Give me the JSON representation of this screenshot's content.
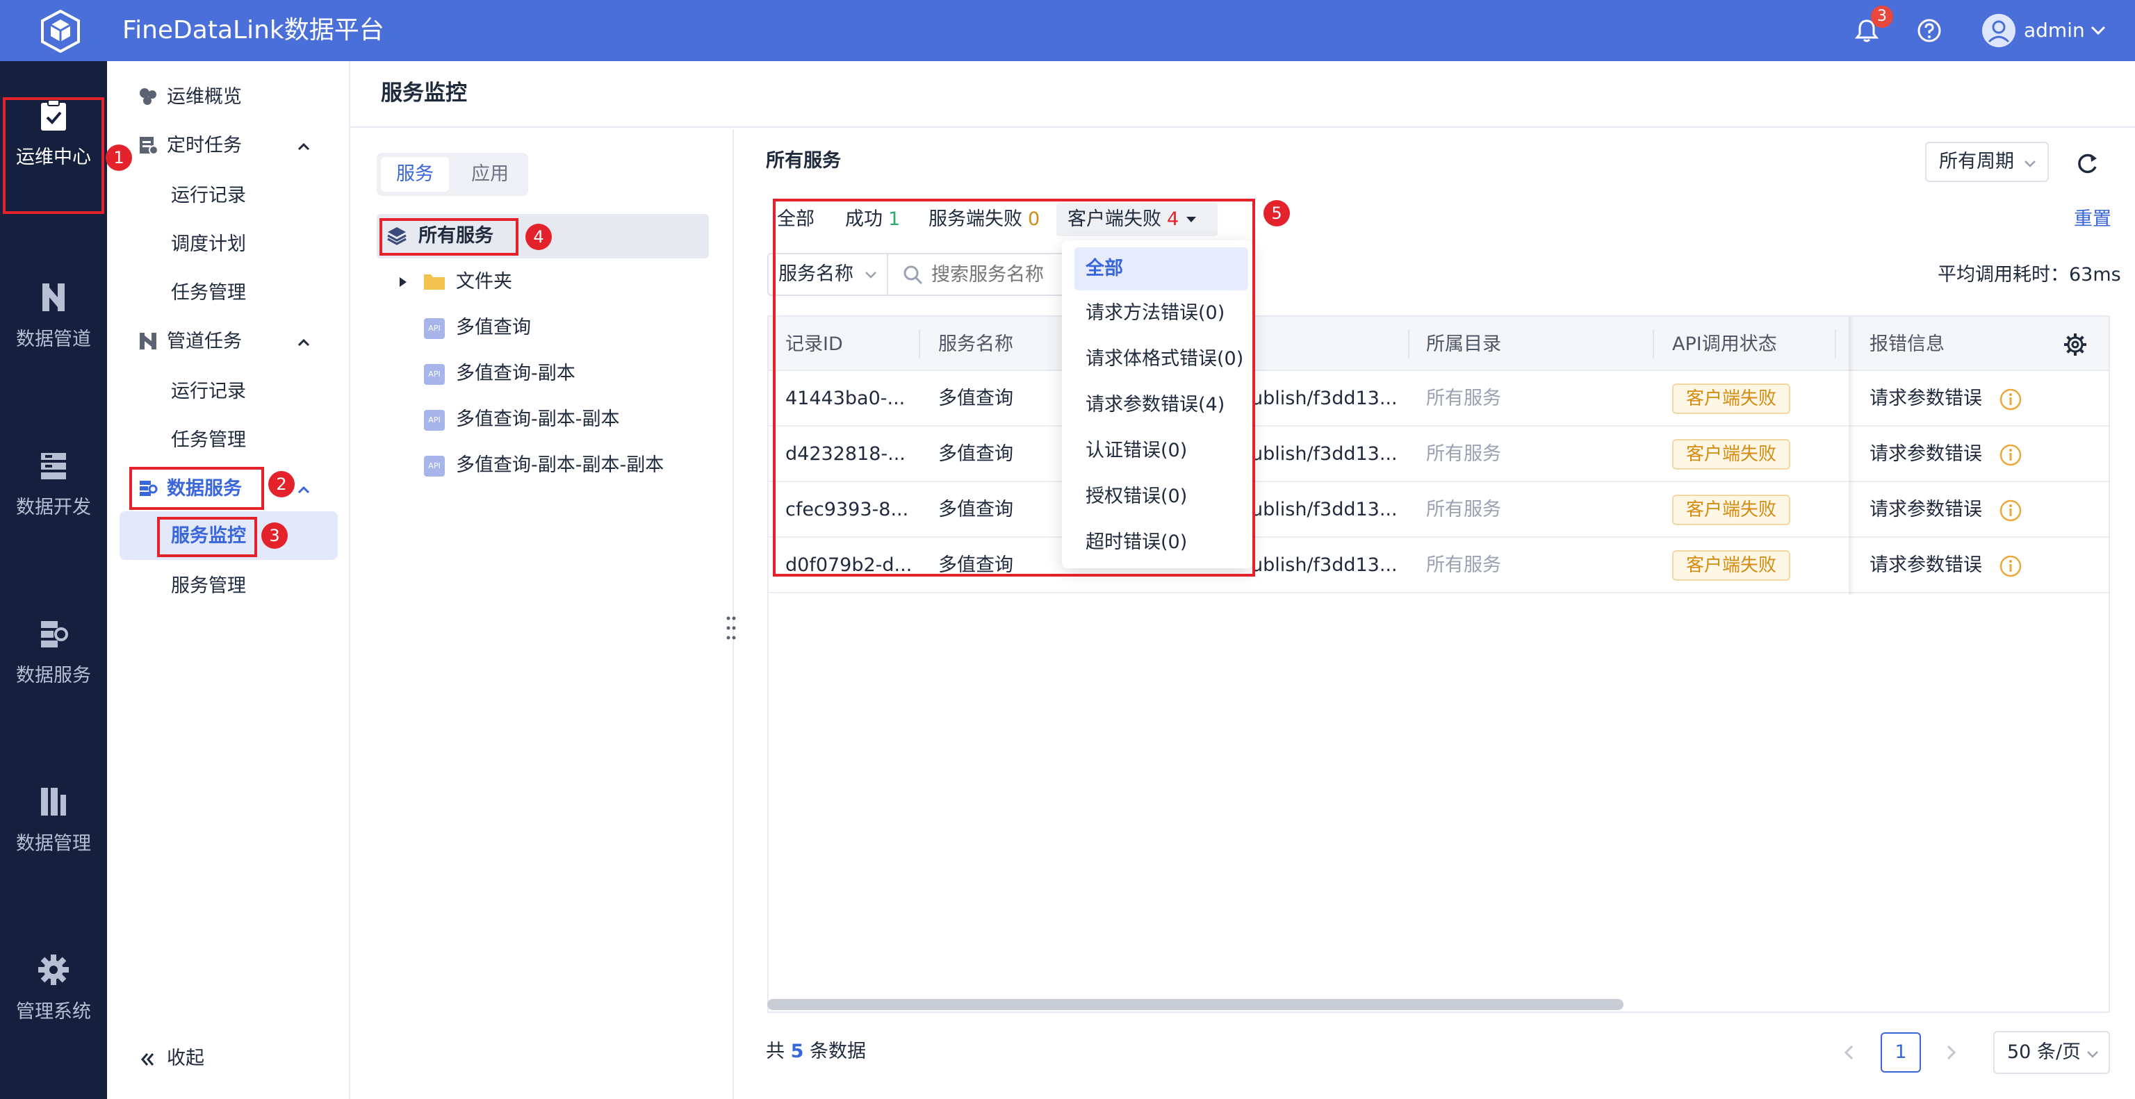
{
  "app": {
    "title": "FineDataLink数据平台",
    "notification_count": "3",
    "username": "admin"
  },
  "rail": {
    "items": [
      {
        "label": "运维中心",
        "icon": "clipboard-check-icon"
      },
      {
        "label": "数据管道",
        "icon": "pipeline-icon"
      },
      {
        "label": "数据开发",
        "icon": "server-stack-icon"
      },
      {
        "label": "数据服务",
        "icon": "service-icon"
      },
      {
        "label": "数据管理",
        "icon": "database-manage-icon"
      },
      {
        "label": "管理系统",
        "icon": "gear-icon"
      }
    ]
  },
  "sidebar": {
    "overview": "运维概览",
    "scheduled": {
      "label": "定时任务",
      "children": [
        "运行记录",
        "调度计划",
        "任务管理"
      ]
    },
    "pipeline": {
      "label": "管道任务",
      "children": [
        "运行记录",
        "任务管理"
      ]
    },
    "data_service": {
      "label": "数据服务",
      "children": [
        "服务监控",
        "服务管理"
      ]
    },
    "collapse": "收起"
  },
  "page": {
    "title": "服务监控"
  },
  "tree": {
    "tabs": [
      "服务",
      "应用"
    ],
    "root": "所有服务",
    "folder": "文件夹",
    "items": [
      "多值查询",
      "多值查询-副本",
      "多值查询-副本-副本",
      "多值查询-副本-副本-副本"
    ],
    "api_badge": "API"
  },
  "content": {
    "title": "所有服务",
    "period": "所有周期",
    "filters": {
      "all": "全部",
      "success": "成功",
      "success_count": "1",
      "server_fail": "服务端失败",
      "server_fail_count": "0",
      "client_fail": "客户端失败",
      "client_fail_count": "4"
    },
    "reset": "重置",
    "search": {
      "field": "服务名称",
      "placeholder": "搜索服务名称"
    },
    "avg_latency": "平均调用耗时：63ms",
    "dropdown": [
      "全部",
      "请求方法错误(0)",
      "请求体格式错误(0)",
      "请求参数错误(4)",
      "认证错误(0)",
      "授权错误(0)",
      "超时错误(0)"
    ],
    "table": {
      "headers": [
        "记录ID",
        "服务名称",
        "所属目录",
        "API调用状态",
        "报错信息"
      ],
      "rows": [
        {
          "id": "41443ba0-...",
          "name": "多值查询",
          "path": "ublish/f3dd13...",
          "dir": "所有服务",
          "status": "客户端失败",
          "error": "请求参数错误"
        },
        {
          "id": "d4232818-...",
          "name": "多值查询",
          "path": "ublish/f3dd13...",
          "dir": "所有服务",
          "status": "客户端失败",
          "error": "请求参数错误"
        },
        {
          "id": "cfec9393-8...",
          "name": "多值查询",
          "path": "ublish/f3dd13...",
          "dir": "所有服务",
          "status": "客户端失败",
          "error": "请求参数错误"
        },
        {
          "id": "d0f079b2-d...",
          "name": "多值查询",
          "path": "ublish/f3dd13...",
          "dir": "所有服务",
          "status": "客户端失败",
          "error": "请求参数错误"
        }
      ]
    },
    "footer": {
      "prefix": "共",
      "count": "5",
      "suffix": "条数据",
      "page": "1",
      "page_size": "50 条/页"
    }
  },
  "annotations": [
    "1",
    "2",
    "3",
    "4",
    "5"
  ],
  "colors": {
    "topbar": "#4a6fd8",
    "rail": "#14203d",
    "accent": "#3a66db",
    "annotation": "#e3222b",
    "warning": "#d48b12"
  }
}
